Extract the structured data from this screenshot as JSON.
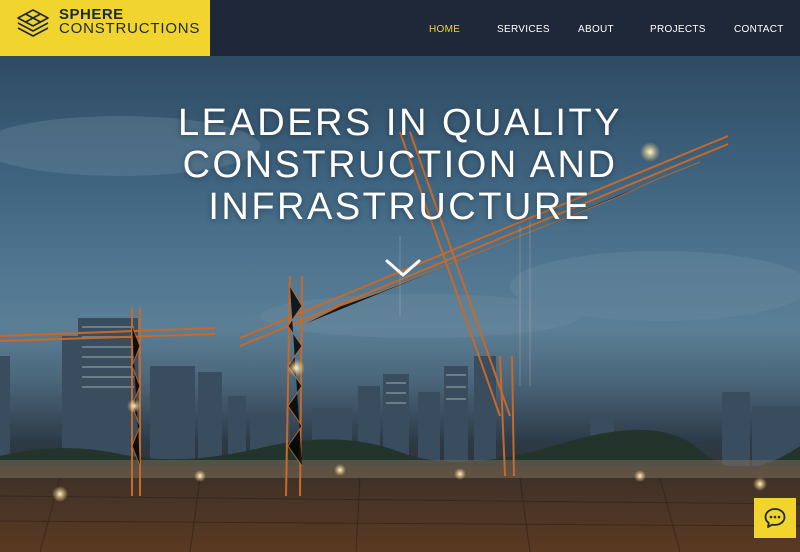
{
  "brand": {
    "name_line1": "SPHERE",
    "name_line2": "CONSTRUCTIONS",
    "logo_icon": "layered-diamond-icon",
    "accent_color": "#f1d42d",
    "header_color": "#1e2838"
  },
  "nav": {
    "items": [
      {
        "label": "HOME",
        "active": true
      },
      {
        "label": "SERVICES",
        "active": false
      },
      {
        "label": "ABOUT",
        "active": false
      },
      {
        "label": "PROJECTS",
        "active": false
      },
      {
        "label": "CONTACT",
        "active": false
      }
    ],
    "active_color": "#f1d42d"
  },
  "hero": {
    "headline_line1": "LEADERS IN QUALITY",
    "headline_line2": "CONSTRUCTION AND",
    "headline_line3": "INFRASTRUCTURE",
    "scroll_icon": "chevron-down-icon",
    "background": "construction-site-cranes-dusk-photo"
  },
  "chat": {
    "icon": "chat-bubble-icon",
    "color": "#f1d42d"
  }
}
